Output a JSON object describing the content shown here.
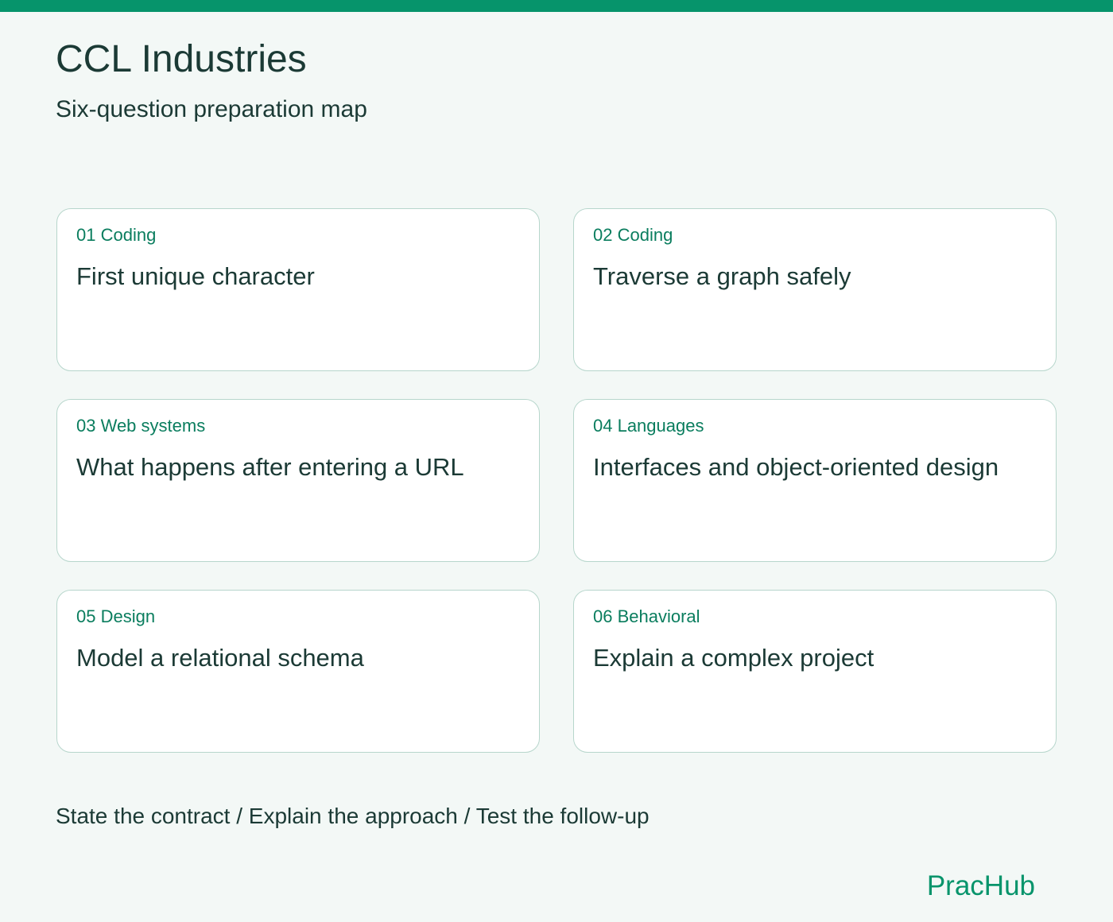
{
  "header": {
    "title": "CCL Industries",
    "subtitle": "Six-question preparation map"
  },
  "cards": [
    {
      "tag": "01 Coding",
      "question": "First unique character"
    },
    {
      "tag": "02 Coding",
      "question": "Traverse a graph safely"
    },
    {
      "tag": "03 Web systems",
      "question": "What happens after entering a URL"
    },
    {
      "tag": "04 Languages",
      "question": "Interfaces and object-oriented design"
    },
    {
      "tag": "05 Design",
      "question": "Model a relational schema"
    },
    {
      "tag": "06 Behavioral",
      "question": "Explain a complex project"
    }
  ],
  "footer": {
    "note": "State the contract / Explain the approach / Test the follow-up",
    "brand": "PracHub"
  },
  "colors": {
    "accent": "#06946b",
    "background": "#f3f8f6",
    "card_border": "#b7d6cc",
    "text": "#1b3a35",
    "tag_text": "#0a7d5e"
  }
}
